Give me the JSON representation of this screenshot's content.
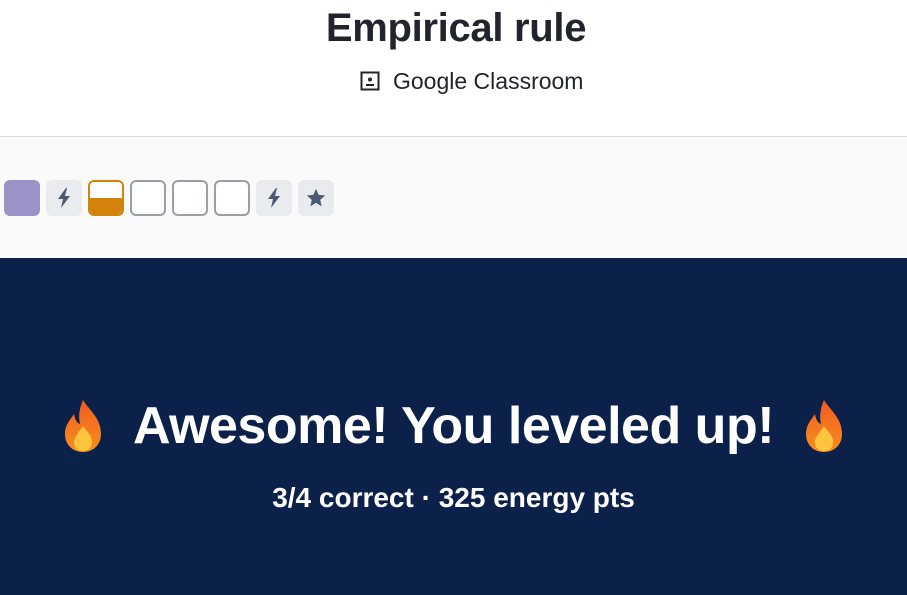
{
  "header": {
    "title": "Empirical rule",
    "classroom_label": "Google Classroom",
    "classroom_icon": "google-classroom-icon"
  },
  "progress": {
    "tiles": [
      {
        "kind": "completed",
        "color": "#9b93c8"
      },
      {
        "kind": "energy",
        "icon": "lightning-bolt-icon"
      },
      {
        "kind": "in-progress",
        "color": "#d3820a",
        "fill_fraction": 0.5
      },
      {
        "kind": "empty"
      },
      {
        "kind": "empty"
      },
      {
        "kind": "empty"
      },
      {
        "kind": "energy",
        "icon": "lightning-bolt-icon"
      },
      {
        "kind": "mastery",
        "icon": "star-icon"
      }
    ]
  },
  "banner": {
    "background": "#0c2149",
    "message": "Awesome! You leveled up!",
    "stats": "3/4 correct · 325 energy pts",
    "decoration_icon": "fire-icon"
  }
}
